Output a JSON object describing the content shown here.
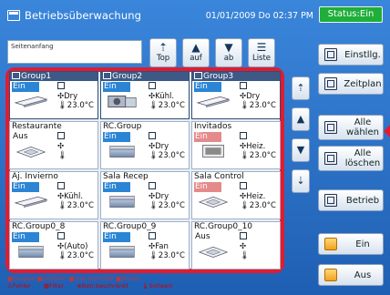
{
  "header": {
    "title": "Betriebsüberwachung",
    "datetime": "01/01/2009 Do 02:37 PM",
    "status": "Status:Ein"
  },
  "name_field": {
    "label": "Seitenanfang"
  },
  "nav": [
    {
      "glyph": "⇡",
      "label": "Top"
    },
    {
      "glyph": "▲",
      "label": "auf"
    },
    {
      "glyph": "▼",
      "label": "ab"
    },
    {
      "glyph": "☰",
      "label": "Liste"
    }
  ],
  "right": {
    "settings": "Einstllg.",
    "schedule": "Zeitplan",
    "select_all_1": "Alle",
    "select_all_2": "wählen",
    "clear_all_1": "Alle",
    "clear_all_2": "löschen",
    "operation": "Betrieb",
    "on": "Ein",
    "off": "Aus"
  },
  "tiles": [
    {
      "name": "Group1",
      "state": "Ein",
      "mode": "Dry",
      "temp": "23.0°C",
      "type": "on",
      "selected": true,
      "unit": "ceiling"
    },
    {
      "name": "Group2",
      "state": "Ein",
      "mode": "Kühl.",
      "temp": "23.0°C",
      "type": "on",
      "selected": true,
      "unit": "outdoor"
    },
    {
      "name": "Group3",
      "state": "Ein",
      "mode": "Dry",
      "temp": "23.0°C",
      "type": "on",
      "selected": true,
      "unit": "ceiling"
    },
    {
      "name": "Restaurante",
      "state": "Aus",
      "mode": "",
      "temp": "",
      "type": "off",
      "selected": false,
      "unit": "cassette"
    },
    {
      "name": "RC.Group",
      "state": "Ein",
      "mode": "Dry",
      "temp": "23.0°C",
      "type": "on",
      "selected": false,
      "unit": "box"
    },
    {
      "name": "Invitados",
      "state": "Ein",
      "mode": "Heiz.",
      "temp": "23.0°C",
      "type": "heat",
      "selected": false,
      "unit": "floor"
    },
    {
      "name": "Aj. Invierno",
      "state": "Ein",
      "mode": "Kühl.",
      "temp": "23.0°C",
      "type": "on",
      "selected": false,
      "unit": "ceiling"
    },
    {
      "name": "Sala Recep",
      "state": "Ein",
      "mode": "Dry",
      "temp": "23.0°C",
      "type": "on",
      "selected": false,
      "unit": "box"
    },
    {
      "name": "Sala Control",
      "state": "Ein",
      "mode": "Heiz.",
      "temp": "23.0°C",
      "type": "heat",
      "selected": false,
      "unit": "cassette"
    },
    {
      "name": "RC.Group0_8",
      "state": "Ein",
      "mode": "(Auto)",
      "temp": "23.0°C",
      "type": "on",
      "selected": false,
      "unit": "box"
    },
    {
      "name": "RC.Group0_9",
      "state": "Ein",
      "mode": "Fan",
      "temp": "23.0°C",
      "type": "on",
      "selected": false,
      "unit": "box"
    },
    {
      "name": "RC.Group0_10",
      "state": "Aus",
      "mode": "",
      "temp": "",
      "type": "off",
      "selected": false,
      "unit": "cassette"
    }
  ],
  "legend": {
    "row1": "■Gruppe ■Zeitplan ■Sub-Kontrolle ■Modus",
    "fehler": "Fehler",
    "filter": "Filter",
    "betr": "Betr.beschränkt",
    "sollwert": "Sollwert"
  },
  "colors": {
    "frame_blue": "#2b6fc2",
    "accent_red": "#e31b2f",
    "status_green": "#1fae3a",
    "on_blue": "#2b85d4",
    "heat_pink": "#e58a8a"
  }
}
